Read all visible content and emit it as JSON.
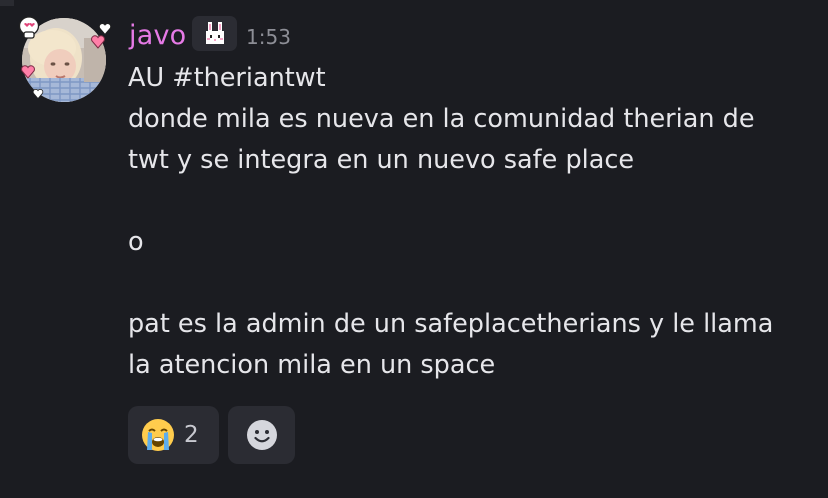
{
  "message": {
    "author": "javo",
    "timestamp": "1:53",
    "author_badge_icon": "bunny-icon",
    "author_color": "#e67ae6",
    "lines": [
      "AU #theriantwt",
      "donde mila es nueva en la comunidad therian de",
      "twt y se integra en un nuevo safe place",
      "",
      "o",
      "",
      "pat es la admin de un safeplacetherians y le llama",
      "la atencion mila en un space"
    ]
  },
  "reactions": [
    {
      "emoji_icon": "loudly-crying-face-icon",
      "count": "2"
    }
  ],
  "add_reaction_icon": "smiley-face-icon"
}
